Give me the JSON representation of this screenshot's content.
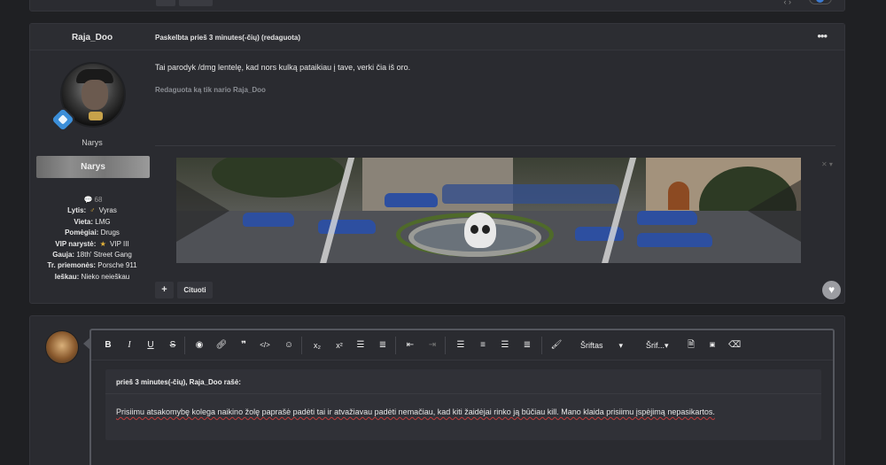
{
  "previous_post": {},
  "post": {
    "author": "Raja_Doo",
    "meta": "Paskelbta prieš 3 minutes(-čių) (redaguota)",
    "more_icon": "more-horizontal-icon",
    "role_text": "Narys",
    "role_banner": "Narys",
    "stats": {
      "posts_count": "68",
      "gender_label": "Lytis:",
      "gender_value": "Vyras",
      "location_label": "Vieta:",
      "location_value": "LMG",
      "hobbies_label": "Pomėgiai:",
      "hobbies_value": "Drugs",
      "vip_label": "VIP narystė:",
      "vip_value": "VIP III",
      "gang_label": "Gauja:",
      "gang_value": "18th' Street Gang",
      "vehicle_label": "Tr. priemonės:",
      "vehicle_value": "Porsche 911",
      "search_label": "Ieškau:",
      "search_value": "Nieko neieškau"
    },
    "body": "Tai parodyk /dmg lentelę, kad nors kulką pataikiau į tave, verki čia iš oro.",
    "edited_note": "Redaguota ką tik nario Raja_Doo",
    "plus_label": "+",
    "quote_label": "Cituoti",
    "like_icon": "heart-icon"
  },
  "editor": {
    "toolbar": {
      "bold": "B",
      "italic": "I",
      "underline": "U",
      "strike": "S",
      "font_label": "Šriftas",
      "size_label": "Šrif..."
    },
    "quote_header": "prieš 3 minutes(-čių), Raja_Doo rašė:",
    "quote_text": "Prisiimu atsakomybę kolega naikino žolę paprašė padėti tai ir atvažiavau padėti nemačiau, kad kiti žaidėjai rinko ją būčiau kill. Mano klaida prisiimu įspėjimą nepasikartos."
  },
  "colors": {
    "background": "#1f2023",
    "panel": "#2a2b30",
    "accent_badge": "#3b8ed8",
    "spell_error": "#c23b3b"
  }
}
